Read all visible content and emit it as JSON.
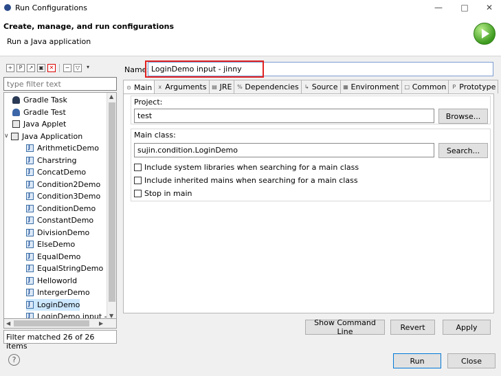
{
  "window": {
    "title": "Run Configurations",
    "minimize": "—",
    "maximize": "□",
    "close": "✕"
  },
  "banner": {
    "heading": "Create, manage, and run configurations",
    "subtitle": "Run a Java application"
  },
  "left": {
    "filter_placeholder": "type filter text",
    "tree": [
      {
        "label": "Gradle Task",
        "icon": "gradle-icon",
        "level": 0
      },
      {
        "label": "Gradle Test",
        "icon": "gradle-icon",
        "level": 0
      },
      {
        "label": "Java Applet",
        "icon": "applet-icon",
        "level": 0
      },
      {
        "label": "Java Application",
        "icon": "java-app-icon",
        "level": 0,
        "expanded": true
      },
      {
        "label": "ArithmeticDemo",
        "level": 1
      },
      {
        "label": "Charstring",
        "level": 1
      },
      {
        "label": "ConcatDemo",
        "level": 1
      },
      {
        "label": "Condition2Demo",
        "level": 1
      },
      {
        "label": "Condition3Demo",
        "level": 1
      },
      {
        "label": "ConditionDemo",
        "level": 1
      },
      {
        "label": "ConstantDemo",
        "level": 1
      },
      {
        "label": "DivisionDemo",
        "level": 1
      },
      {
        "label": "ElseDemo",
        "level": 1
      },
      {
        "label": "EqualDemo",
        "level": 1
      },
      {
        "label": "EqualStringDemo",
        "level": 1
      },
      {
        "label": "Helloworld",
        "level": 1
      },
      {
        "label": "IntergerDemo",
        "level": 1
      },
      {
        "label": "LoginDemo",
        "level": 1,
        "selected": true
      },
      {
        "label": "LoginDemo input - jinny",
        "level": 1
      }
    ],
    "filter_status": "Filter matched 26 of 26 items"
  },
  "right": {
    "name_label": "Name:",
    "name_value": "LoginDemo input - jinny",
    "highlight_color": "#e02020",
    "tabs": [
      {
        "label": "Main",
        "icon": "main-icon"
      },
      {
        "label": "Arguments",
        "icon": "arguments-icon"
      },
      {
        "label": "JRE",
        "icon": "jre-icon"
      },
      {
        "label": "Dependencies",
        "icon": "dependencies-icon"
      },
      {
        "label": "Source",
        "icon": "source-icon"
      },
      {
        "label": "Environment",
        "icon": "environment-icon"
      },
      {
        "label": "Common",
        "icon": "common-icon"
      },
      {
        "label": "Prototype",
        "icon": "prototype-icon"
      }
    ],
    "project_label": "Project:",
    "project_value": "test",
    "browse_label": "Browse...",
    "main_class_label": "Main class:",
    "main_class_value": "sujin.condition.LoginDemo",
    "search_label": "Search...",
    "checkboxes": [
      {
        "label": "Include system libraries when searching for a main class",
        "checked": false
      },
      {
        "label": "Include inherited mains when searching for a main class",
        "checked": false
      },
      {
        "label": "Stop in main",
        "checked": false
      }
    ],
    "show_command_line": "Show Command Line",
    "revert": "Revert",
    "apply": "Apply"
  },
  "footer": {
    "help": "?",
    "run": "Run",
    "close": "Close"
  }
}
